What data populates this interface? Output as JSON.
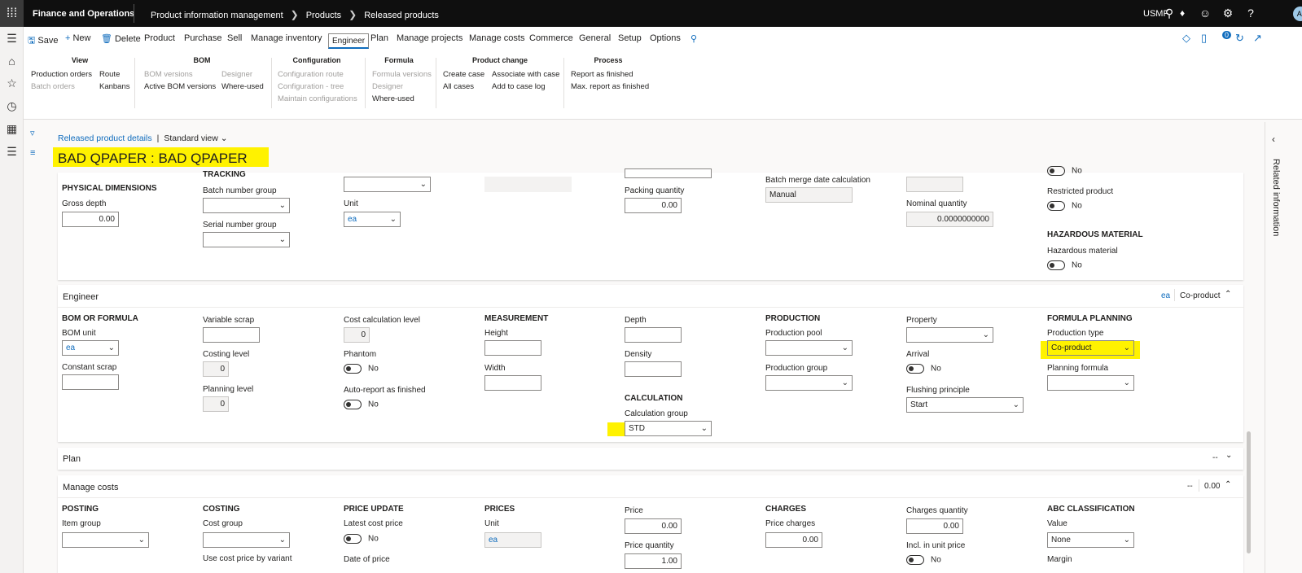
{
  "topbar": {
    "app_name": "Finance and Operations",
    "breadcrumbs": [
      "Product information management",
      "Products",
      "Released products"
    ],
    "company": "USMF",
    "avatar_initials": "AI"
  },
  "actionbar": {
    "save": "Save",
    "new": "New",
    "delete": "Delete",
    "tabs": [
      "Product",
      "Purchase",
      "Sell",
      "Manage inventory",
      "Engineer",
      "Plan",
      "Manage projects",
      "Manage costs",
      "Commerce",
      "General",
      "Setup",
      "Options"
    ],
    "selected_tab": "Engineer",
    "notification_count": "0"
  },
  "ribbon": {
    "view": {
      "header": "View",
      "col1": [
        "Production orders",
        "Batch orders"
      ],
      "col2": [
        "Route",
        "Kanbans"
      ]
    },
    "bom": {
      "header": "BOM",
      "col1": [
        "BOM versions",
        "Active BOM versions"
      ],
      "col2": [
        "Designer",
        "Where-used"
      ]
    },
    "configuration": {
      "header": "Configuration",
      "col1": [
        "Configuration route",
        "Configuration - tree",
        "Maintain configurations"
      ]
    },
    "formula": {
      "header": "Formula",
      "col1": [
        "Formula versions",
        "Designer",
        "Where-used"
      ]
    },
    "product_change": {
      "header": "Product change",
      "col1": [
        "Create case",
        "All cases"
      ],
      "col2": [
        "Associate with case",
        "Add to case log"
      ]
    },
    "process": {
      "header": "Process",
      "col1": [
        "Report as finished",
        "Max. report as finished"
      ]
    }
  },
  "page": {
    "breadcrumb_link": "Released product details",
    "view": "Standard view",
    "title": "BAD QPAPER : BAD QPAPER",
    "related_info": "Related information"
  },
  "top_card": {
    "physical_dimensions": "PHYSICAL DIMENSIONS",
    "gross_depth_label": "Gross depth",
    "gross_depth": "0.00",
    "tracking": "TRACKING",
    "batch_number_group": "Batch number group",
    "serial_number_group": "Serial number group",
    "unit_label": "Unit",
    "unit": "ea",
    "packing_quantity_label": "Packing quantity",
    "packing_quantity": "0.00",
    "batch_merge_label": "Batch merge date calculation",
    "batch_merge": "Manual",
    "nominal_quantity_label": "Nominal quantity",
    "nominal_quantity": "0.0000000000",
    "top_no": "No",
    "restricted_product_label": "Restricted product",
    "restricted_product": "No",
    "hazardous_material_section": "HAZARDOUS MATERIAL",
    "hazardous_material_label": "Hazardous material",
    "hazardous_material": "No"
  },
  "engineer": {
    "header": "Engineer",
    "summary_unit": "ea",
    "summary_type": "Co-product",
    "bom_or_formula": "BOM OR FORMULA",
    "bom_unit_label": "BOM unit",
    "bom_unit": "ea",
    "constant_scrap_label": "Constant scrap",
    "variable_scrap_label": "Variable scrap",
    "costing_level_label": "Costing level",
    "costing_level": "0",
    "planning_level_label": "Planning level",
    "planning_level": "0",
    "cost_calc_level_label": "Cost calculation level",
    "cost_calc_level": "0",
    "phantom_label": "Phantom",
    "phantom": "No",
    "auto_report_label": "Auto-report as finished",
    "auto_report": "No",
    "measurement": "MEASUREMENT",
    "height_label": "Height",
    "width_label": "Width",
    "depth_label": "Depth",
    "density_label": "Density",
    "calculation": "CALCULATION",
    "calculation_group_label": "Calculation group",
    "calculation_group": "STD",
    "production": "PRODUCTION",
    "production_pool_label": "Production pool",
    "production_group_label": "Production group",
    "property_label": "Property",
    "arrival_label": "Arrival",
    "arrival": "No",
    "flushing_principle_label": "Flushing principle",
    "flushing_principle": "Start",
    "formula_planning": "FORMULA PLANNING",
    "production_type_label": "Production type",
    "production_type": "Co-product",
    "planning_formula_label": "Planning formula"
  },
  "plan": {
    "header": "Plan",
    "summary": "--"
  },
  "manage_costs": {
    "header": "Manage costs",
    "summary_a": "--",
    "summary_b": "0.00",
    "posting": "POSTING",
    "item_group_label": "Item group",
    "costing": "COSTING",
    "cost_group_label": "Cost group",
    "use_cost_price_label": "Use cost price by variant",
    "price_update": "PRICE UPDATE",
    "latest_cost_price_label": "Latest cost price",
    "latest_cost_price": "No",
    "date_of_price_label": "Date of price",
    "prices": "PRICES",
    "unit_label": "Unit",
    "unit": "ea",
    "price_label": "Price",
    "price": "0.00",
    "price_quantity_label": "Price quantity",
    "price_quantity": "1.00",
    "charges": "CHARGES",
    "price_charges_label": "Price charges",
    "price_charges": "0.00",
    "charges_quantity_label": "Charges quantity",
    "charges_quantity": "0.00",
    "incl_unit_price_label": "Incl. in unit price",
    "incl_unit_price": "No",
    "abc_classification": "ABC CLASSIFICATION",
    "value_label": "Value",
    "value": "None",
    "margin_label": "Margin"
  }
}
